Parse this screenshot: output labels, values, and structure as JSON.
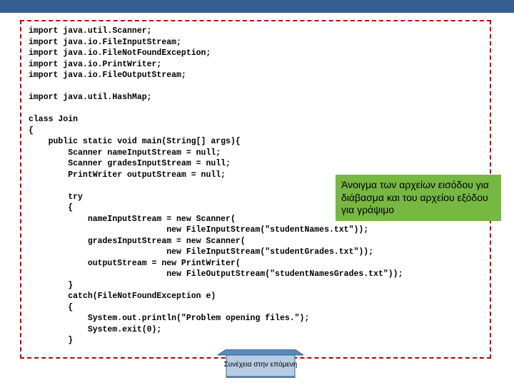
{
  "code": "import java.util.Scanner;\nimport java.io.FileInputStream;\nimport java.io.FileNotFoundException;\nimport java.io.PrintWriter;\nimport java.io.FileOutputStream;\n\nimport java.util.HashMap;\n\nclass Join\n{\n    public static void main(String[] args){\n        Scanner nameInputStream = null;\n        Scanner gradesInputStream = null;\n        PrintWriter outputStream = null;\n\n        try\n        {\n            nameInputStream = new Scanner(\n                            new FileInputStream(\"studentNames.txt\"));\n            gradesInputStream = new Scanner(\n                            new FileInputStream(\"studentGrades.txt\"));\n            outputStream = new PrintWriter(\n                            new FileOutputStream(\"studentNamesGrades.txt\"));\n        }\n        catch(FileNotFoundException e)\n        {\n            System.out.println(\"Problem opening files.\");\n            System.exit(0);\n        }",
  "callout": "Άνοιγμα των αρχείων εισόδου για διάβασμα και του αρχείου εξόδου για γράψιμο",
  "continue_label": "Συνέχεια στην επόμενη"
}
